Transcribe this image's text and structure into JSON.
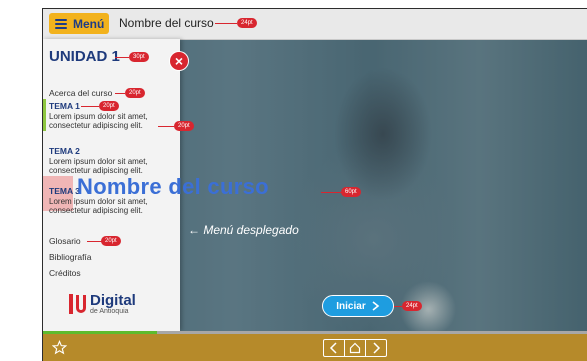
{
  "header": {
    "menu_label": "Menú",
    "course_name": "Nombre del curso",
    "course_name_pt": "24pt"
  },
  "side_menu": {
    "unit_title": "UNIDAD 1",
    "unit_title_pt": "30pt",
    "about": "Acerca del curso",
    "about_pt": "20pt",
    "temas": [
      {
        "title": "TEMA 1",
        "title_pt": "20pt",
        "desc1": "Lorem ipsum dolor sit amet,",
        "desc2": "consectetur adipiscing elit.",
        "desc_pt": "20pt"
      },
      {
        "title": "TEMA 2",
        "desc1": "Lorem ipsum dolor sit amet,",
        "desc2": "consectetur adipiscing elit."
      },
      {
        "title": "TEMA 3",
        "desc1": "Lorem ipsum dolor sit amet,",
        "desc2": "consectetur adipiscing elit."
      }
    ],
    "glossary": "Glosario",
    "glossary_pt": "20pt",
    "bibliography": "Bibliografía",
    "credits": "Créditos",
    "logo_main": "Digital",
    "logo_sub": "de Antioquia"
  },
  "hero": {
    "course_title": "Nombre del curso",
    "course_title_pt": "60pt",
    "menu_note": "← Menú desplegado",
    "start_label": "Iniciar",
    "start_pt": "24pt"
  },
  "colors": {
    "accent_yellow": "#f2b21d",
    "brand_blue": "#1e3a7c",
    "annotation_red": "#d8262f",
    "start_blue": "#1e9de0"
  },
  "progress": 0.21
}
